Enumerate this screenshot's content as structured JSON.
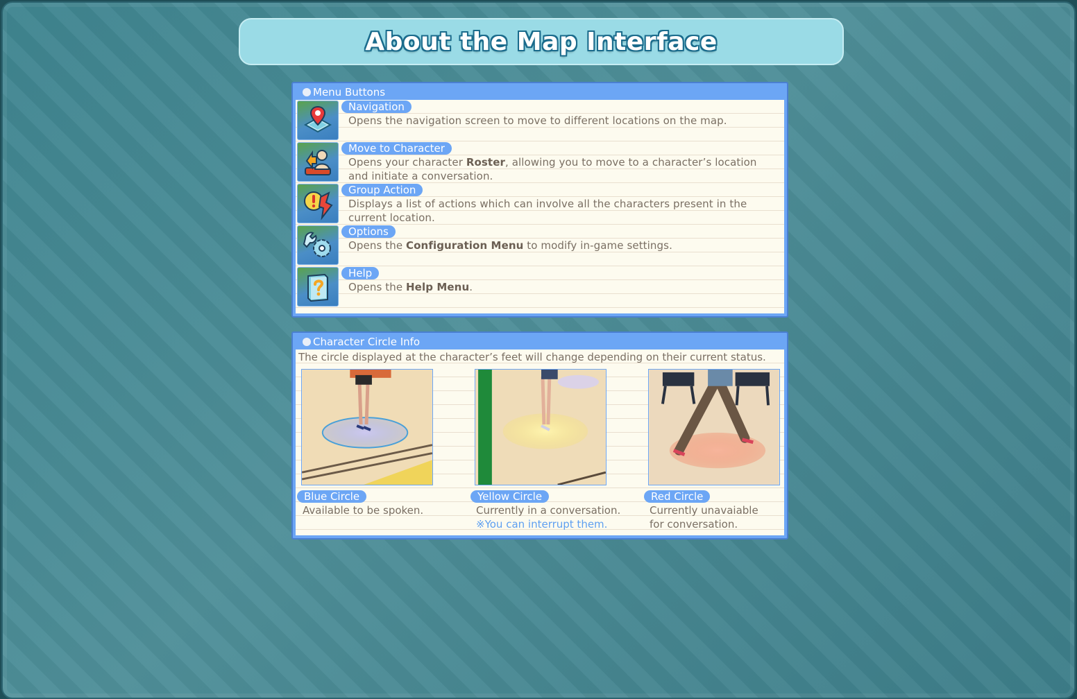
{
  "title": "About the Map Interface",
  "menu_panel": {
    "header": "Menu Buttons",
    "items": [
      {
        "label": "Navigation",
        "icon": "map-pin-icon",
        "desc_parts": [
          {
            "t": "Opens the navigation screen to move to different locations on the map.",
            "b": false
          }
        ]
      },
      {
        "label": "Move to Character",
        "icon": "character-move-icon",
        "desc_parts": [
          {
            "t": "Opens your character ",
            "b": false
          },
          {
            "t": "Roster",
            "b": true
          },
          {
            "t": ", allowing you to move to a character’s location and initiate a conversation.",
            "b": false
          }
        ]
      },
      {
        "label": "Group Action",
        "icon": "group-action-icon",
        "desc_parts": [
          {
            "t": "Displays a list of actions which can involve all  the characters present in the current location.",
            "b": false
          }
        ]
      },
      {
        "label": "Options",
        "icon": "wrench-gear-icon",
        "desc_parts": [
          {
            "t": "Opens the ",
            "b": false
          },
          {
            "t": "Configuration Menu",
            "b": true
          },
          {
            "t": " to modify in-game settings.",
            "b": false
          }
        ]
      },
      {
        "label": "Help",
        "icon": "help-book-icon",
        "desc_parts": [
          {
            "t": "Opens the ",
            "b": false
          },
          {
            "t": "Help Menu",
            "b": true
          },
          {
            "t": ".",
            "b": false
          }
        ]
      }
    ]
  },
  "circle_panel": {
    "header": "Character Circle Info",
    "intro": "The circle displayed at the character’s feet will change depending on their current status.",
    "circles": [
      {
        "label": "Blue Circle",
        "lines": [
          "Available to be spoken."
        ],
        "note": "",
        "color": "#8fa8f0"
      },
      {
        "label": "Yellow Circle",
        "lines": [
          "Currently in a conversation."
        ],
        "note": "※You can interrupt them.",
        "color": "#f5e27a"
      },
      {
        "label": "Red Circle",
        "lines": [
          "Currently unavaiable",
          "for conversation."
        ],
        "note": "",
        "color": "#f28a6a"
      }
    ]
  },
  "colors": {
    "panel_blue": "#6ca6f5",
    "title_bg": "#9adbe6",
    "body_text": "#7a6f63",
    "note_blue": "#5e9ff0"
  }
}
